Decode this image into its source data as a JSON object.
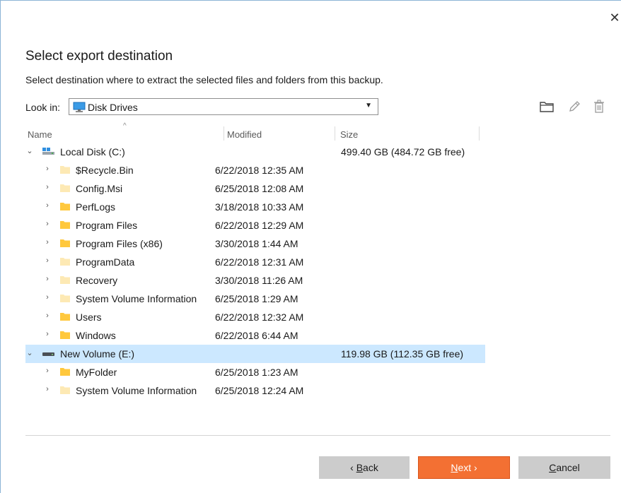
{
  "dialog": {
    "close_glyph": "✕",
    "title": "Select export destination",
    "subtitle": "Select destination where to extract the selected files and folders from this backup."
  },
  "lookin": {
    "label": "Look in:",
    "selected": "Disk Drives",
    "icon": "computer-icon"
  },
  "toolbar": {
    "icons": [
      "new-folder-icon",
      "rename-pencil-icon",
      "delete-trash-icon"
    ]
  },
  "columns": {
    "name": "Name",
    "modified": "Modified",
    "size": "Size"
  },
  "drives": [
    {
      "name": "Local Disk (C:)",
      "size": "499.40 GB (484.72 GB free)",
      "icon": "system-drive-icon",
      "expanded": true,
      "selected": false,
      "children": [
        {
          "name": "$Recycle.Bin",
          "modified": "6/22/2018 12:35 AM",
          "hidden": true
        },
        {
          "name": "Config.Msi",
          "modified": "6/25/2018 12:08 AM",
          "hidden": true
        },
        {
          "name": "PerfLogs",
          "modified": "3/18/2018 10:33 AM",
          "hidden": false
        },
        {
          "name": "Program Files",
          "modified": "6/22/2018 12:29 AM",
          "hidden": false
        },
        {
          "name": "Program Files (x86)",
          "modified": "3/30/2018 1:44 AM",
          "hidden": false
        },
        {
          "name": "ProgramData",
          "modified": "6/22/2018 12:31 AM",
          "hidden": true
        },
        {
          "name": "Recovery",
          "modified": "3/30/2018 11:26 AM",
          "hidden": true
        },
        {
          "name": "System Volume Information",
          "modified": "6/25/2018 1:29 AM",
          "hidden": true
        },
        {
          "name": "Users",
          "modified": "6/22/2018 12:32 AM",
          "hidden": false
        },
        {
          "name": "Windows",
          "modified": "6/22/2018 6:44 AM",
          "hidden": false
        }
      ]
    },
    {
      "name": "New Volume (E:)",
      "size": "119.98 GB (112.35 GB free)",
      "icon": "drive-icon",
      "expanded": true,
      "selected": true,
      "children": [
        {
          "name": "MyFolder",
          "modified": "6/25/2018 1:23 AM",
          "hidden": false
        },
        {
          "name": "System Volume Information",
          "modified": "6/25/2018 12:24 AM",
          "hidden": true
        }
      ]
    }
  ],
  "buttons": {
    "back_prefix": "‹ ",
    "back_key": "B",
    "back_rest": "ack",
    "next_key": "N",
    "next_rest": "ext",
    "next_suffix": " ›",
    "cancel_key": "C",
    "cancel_rest": "ancel"
  },
  "colors": {
    "accent": "#f37033",
    "selection": "#cce8ff",
    "folder": "#ffc83d",
    "folder_hidden": "#fde9b4"
  }
}
